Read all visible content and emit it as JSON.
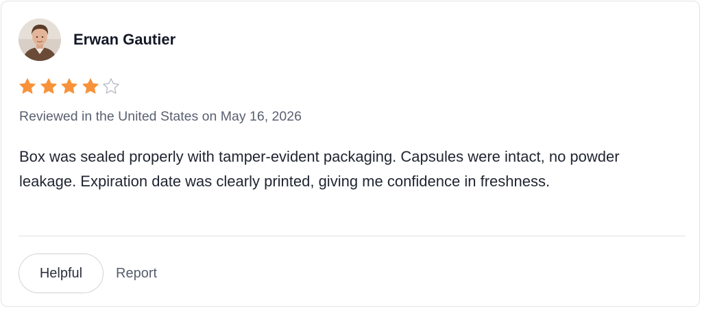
{
  "review": {
    "author_name": "Erwan Gautier",
    "rating": 4,
    "rating_max": 5,
    "star_filled_color": "#F7923A",
    "star_empty_color": "#B8BCC3",
    "meta": "Reviewed in the United States on May 16, 2026",
    "body": "Box was sealed properly with tamper-evident packaging. Capsules were intact, no powder leakage. Expiration date was clearly printed, giving me confidence in freshness."
  },
  "actions": {
    "helpful_label": "Helpful",
    "report_label": "Report"
  }
}
